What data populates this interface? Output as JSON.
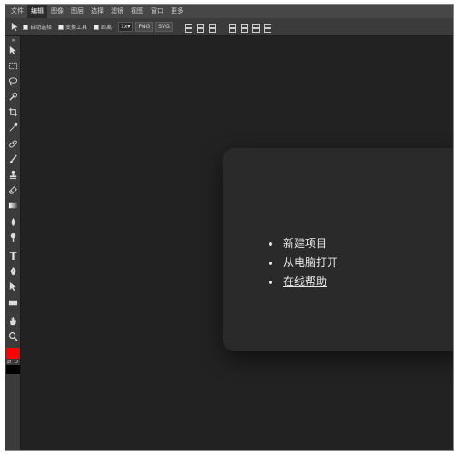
{
  "menu": {
    "items": [
      "文件",
      "编辑",
      "图像",
      "图层",
      "选择",
      "滤镜",
      "视图",
      "窗口",
      "更多"
    ],
    "active_index": 1
  },
  "options": {
    "auto_select_label": "自动选择",
    "transform_label": "变换工具",
    "distance_label": "距离",
    "zoom_select": "1x",
    "png_button": "PNG",
    "svg_button": "SVG"
  },
  "swatches": {
    "foreground": "#ff0000",
    "background": "#000000",
    "swap_label": "⇄",
    "default_label": "D"
  },
  "welcome": {
    "items": [
      "新建项目",
      "从电脑打开",
      "在线帮助"
    ]
  }
}
